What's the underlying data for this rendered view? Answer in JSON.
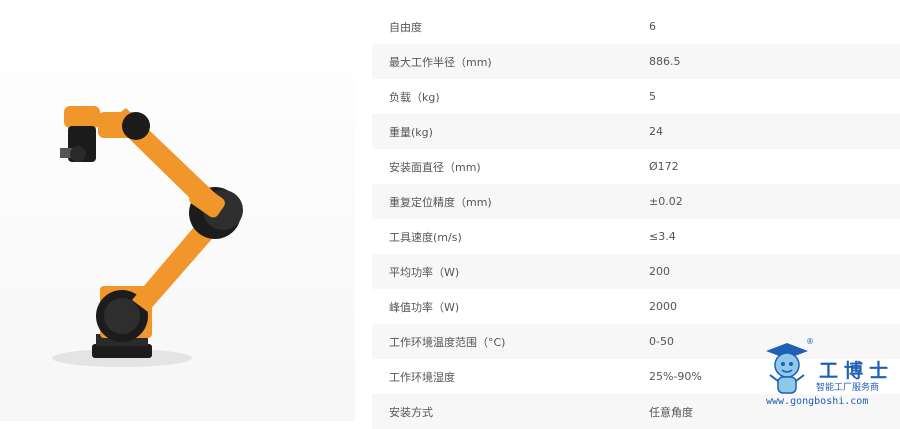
{
  "specs": [
    {
      "label": "自由度",
      "value": "6"
    },
    {
      "label": "最大工作半径（mm)",
      "value": "886.5"
    },
    {
      "label": "负载（kg)",
      "value": "5"
    },
    {
      "label": "重量(kg)",
      "value": "24"
    },
    {
      "label": "安装面直径（mm)",
      "value": "Ø172"
    },
    {
      "label": "重复定位精度（mm)",
      "value": "±0.02"
    },
    {
      "label": "工具速度(m/s)",
      "value": "≤3.4"
    },
    {
      "label": "平均功率（W)",
      "value": "200"
    },
    {
      "label": "峰值功率（W)",
      "value": "2000"
    },
    {
      "label": "工作环境温度范围（°C)",
      "value": "0-50"
    },
    {
      "label": "工作环境湿度",
      "value": "25%-90%"
    },
    {
      "label": "安装方式",
      "value": "任意角度"
    }
  ],
  "watermark": {
    "title": "工博士",
    "subtitle": "智能工厂服务商",
    "url": "www.gongboshi.com",
    "registered_mark": "®"
  },
  "colors": {
    "robot_orange": "#f0962a",
    "robot_black": "#1c1c1c",
    "brand_blue": "#1f5fb6"
  },
  "icons": {
    "robot": "collaborative-robot-arm",
    "mascot": "graduate-mascot"
  }
}
